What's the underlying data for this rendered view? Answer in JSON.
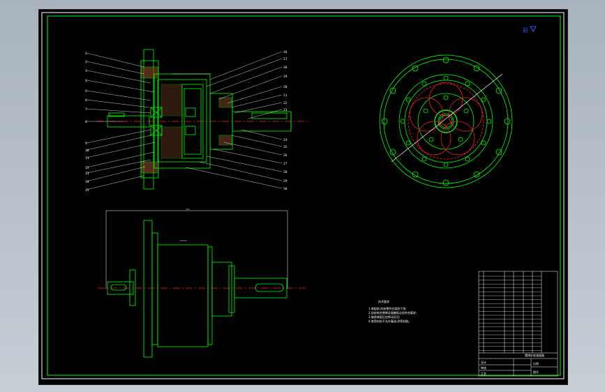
{
  "viewcube": {
    "label": "前",
    "icon": "view-cube-icon"
  },
  "section_view": {
    "left_numbers": [
      "1",
      "2",
      "3",
      "4",
      "5",
      "6",
      "7",
      "8",
      "9",
      "10",
      "11",
      "12",
      "13",
      "14",
      "15"
    ],
    "right_numbers": [
      "16",
      "17",
      "18",
      "19",
      "20",
      "21",
      "22",
      "23",
      "24",
      "25",
      "26",
      "27",
      "28",
      "29",
      "30"
    ]
  },
  "notes": {
    "title": "技术要求",
    "lines": [
      "1.装配前,所有零件应清洗干净;",
      "2.齿轮啮合侧隙及接触斑点应符合要求;",
      "3.轴承装配后应转动灵活;",
      "4.各密封处不允许漏油,涂密封胶。"
    ]
  },
  "title_block": {
    "drawing_name": "摆线针轮减速器",
    "labels": [
      "设计",
      "审核",
      "工艺",
      "比例",
      "图号"
    ]
  },
  "colors": {
    "outline": "#00ff00",
    "centerline": "#ff2020",
    "dimension": "#ffffff",
    "accent": "#2244ff"
  }
}
